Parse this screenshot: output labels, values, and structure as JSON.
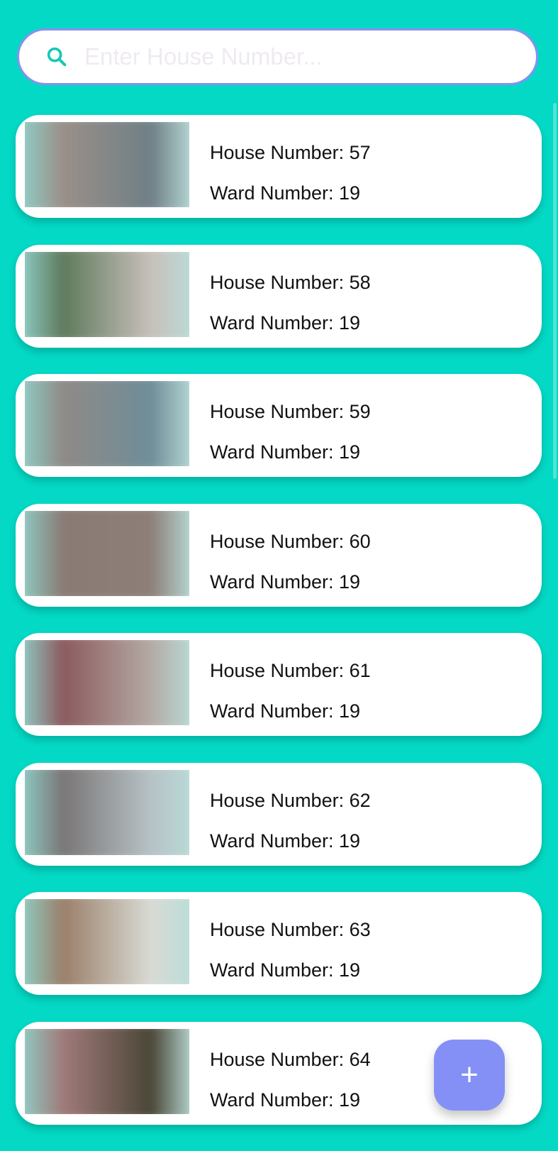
{
  "search": {
    "placeholder": "Enter House Number...",
    "value": ""
  },
  "houses": [
    {
      "house_label": "House Number: 57",
      "ward_label": "Ward Number: 19",
      "thumb": [
        "#9a8f88",
        "#6f7f86"
      ]
    },
    {
      "house_label": "House Number: 58",
      "ward_label": "Ward Number: 19",
      "thumb": [
        "#5f7a5c",
        "#c8c0bb"
      ]
    },
    {
      "house_label": "House Number: 59",
      "ward_label": "Ward Number: 19",
      "thumb": [
        "#8f8a86",
        "#6f8d99"
      ]
    },
    {
      "house_label": "House Number: 60",
      "ward_label": "Ward Number: 19",
      "thumb": [
        "#8a7a74",
        "#8d7f78"
      ]
    },
    {
      "house_label": "House Number: 61",
      "ward_label": "Ward Number: 19",
      "thumb": [
        "#8c5a5e",
        "#b4aaa4"
      ]
    },
    {
      "house_label": "House Number: 62",
      "ward_label": "Ward Number: 19",
      "thumb": [
        "#7a7676",
        "#b7c2c6"
      ]
    },
    {
      "house_label": "House Number: 63",
      "ward_label": "Ward Number: 19",
      "thumb": [
        "#9a7f6a",
        "#d9dbd4"
      ]
    },
    {
      "house_label": "House Number: 64",
      "ward_label": "Ward Number: 19",
      "thumb": [
        "#a07a7a",
        "#4a4636"
      ]
    }
  ],
  "fab": {
    "label": "+"
  },
  "colors": {
    "background": "#03d9c5",
    "accent": "#8490f5",
    "search_border": "#8a8ff0"
  }
}
